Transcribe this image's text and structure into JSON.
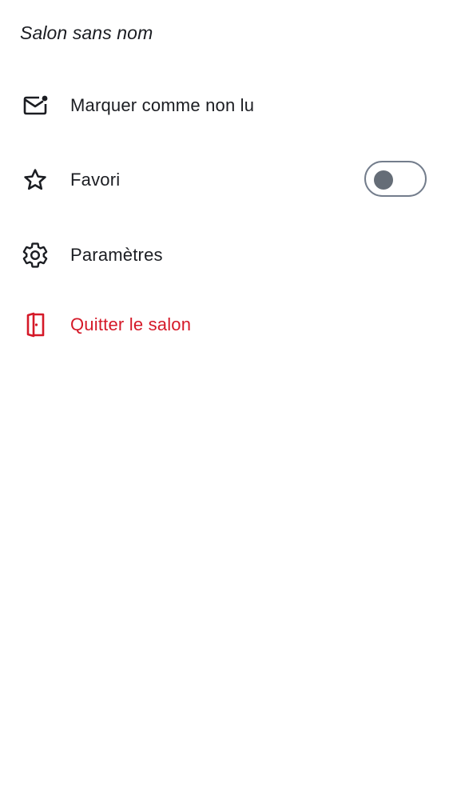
{
  "room": {
    "title": "Salon sans nom"
  },
  "menu": {
    "mark_unread": {
      "label": "Marquer comme non lu",
      "icon": "mail-unread-icon"
    },
    "favourite": {
      "label": "Favori",
      "icon": "star-icon",
      "toggle_on": false
    },
    "settings": {
      "label": "Paramètres",
      "icon": "gear-icon"
    },
    "leave": {
      "label": "Quitter le salon",
      "icon": "leave-door-icon"
    }
  },
  "colors": {
    "text": "#1b1d22",
    "danger": "#d51928",
    "toggle_border": "#737d8c",
    "toggle_knob": "#656d77"
  }
}
